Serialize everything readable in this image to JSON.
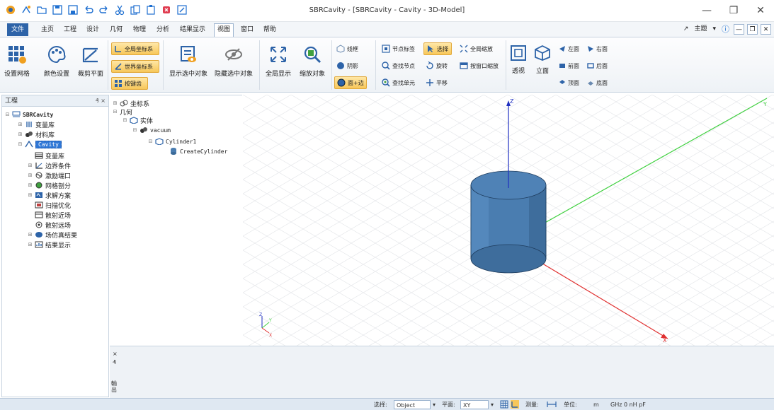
{
  "window": {
    "title": "SBRCavity - [SBRCavity - Cavity - 3D-Model]",
    "controls": {
      "minimize": "—",
      "restore": "❐",
      "close": "✕"
    }
  },
  "quick_access": [
    "app-logo-icon",
    "new-icon",
    "open-icon",
    "save-icon",
    "save-as-icon",
    "undo-icon",
    "redo-icon",
    "cut-icon",
    "copy-icon",
    "paste-icon",
    "delete-icon",
    "edit-icon"
  ],
  "menu": {
    "file": "文件",
    "items": [
      "主页",
      "工程",
      "设计",
      "几何",
      "物理",
      "分析",
      "结果显示",
      "视图",
      "窗口",
      "帮助"
    ],
    "active": "视图",
    "right": {
      "theme": "主题",
      "info": "ⓘ",
      "min": "—",
      "restore": "❐",
      "close": "✕"
    }
  },
  "ribbon": {
    "grid_settings": "设置网格",
    "color_settings": "颜色设置",
    "clip_plane": "裁剪平面",
    "global_coords": "全局坐标系",
    "world_coords": "世界坐标系",
    "by_body": "按键齿",
    "show_selected": "显示选中对象",
    "hide_selected": "隐藏选中对象",
    "show_all": "全局显示",
    "zoom_object": "缩放对象",
    "wireframe": "线框",
    "shadow": "阴影",
    "face_edge": "面+边",
    "node_label": "节点标签",
    "find_node": "查找节点",
    "find_element": "查找单元",
    "select": "选择",
    "rotate": "旋转",
    "pan": "平移",
    "zoom_all": "全局缩放",
    "zoom_window": "按窗口缩放",
    "perspective": "透视",
    "elevation": "立面",
    "left": "左面",
    "right": "右面",
    "front": "前面",
    "back": "后面",
    "top": "顶面",
    "bottom": "底面"
  },
  "project_panel": {
    "title": "工程",
    "pin": "₰ ×",
    "root": "SBRCavity",
    "items": {
      "variables": "变量库",
      "materials": "材料库",
      "cavity": "Cavity",
      "sub_variables": "变量库",
      "boundary": "边界条件",
      "excitation": "激励端口",
      "mesh": "网格剖分",
      "solution": "求解方案",
      "sweep": "扫描优化",
      "near_field": "散射近场",
      "far_field": "散射远场",
      "field_results": "场仿真结果",
      "results_display": "结果显示"
    }
  },
  "model_tree": {
    "coord_system": "坐标系",
    "geometry": "几何",
    "solid": "实体",
    "vacuum": "vacuum",
    "cylinder": "Cylinder1",
    "create_cylinder": "CreateCylinder"
  },
  "output_panel": {
    "close": "×",
    "pin": "₰",
    "tab": "輸出"
  },
  "axes": {
    "z": "Z",
    "y": "Y",
    "x": "X",
    "triad_z": "Z",
    "triad_y": "Y",
    "triad_x": "X"
  },
  "colors": {
    "accent": "#2d63a8",
    "cylinder": "#4a7db0",
    "axis_x": "#e03030",
    "axis_y": "#40d040",
    "axis_z": "#2030c0",
    "highlight": "#f7c75a"
  },
  "statusbar": {
    "select_label": "选择:",
    "select_value": "Object",
    "plane_label": "平面:",
    "plane_value": "XY",
    "measure_label": "测量:",
    "units_label": "单位:",
    "units_length": "m",
    "units_rest": "GHz 0 nH pF"
  }
}
